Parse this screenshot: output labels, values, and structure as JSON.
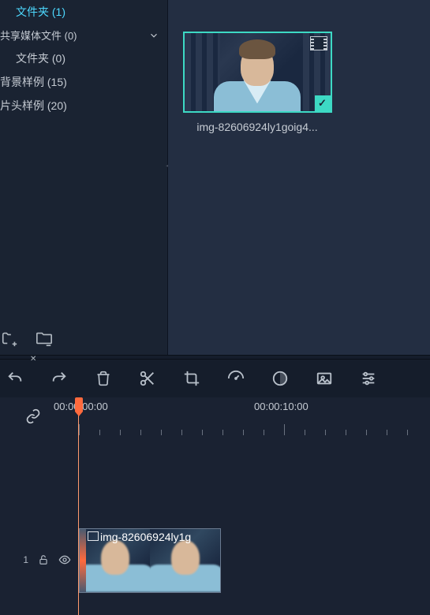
{
  "sidebar": {
    "items": [
      {
        "label": "文件夹 (1)",
        "selected": true,
        "indent": 1
      },
      {
        "label": "共享媒体文件 (0)",
        "expandable": true,
        "indent": 0
      },
      {
        "label": "文件夹 (0)",
        "indent": 2
      },
      {
        "label": "背景样例 (15)",
        "indent": 0
      },
      {
        "label": "片头样例 (20)",
        "indent": 0
      }
    ]
  },
  "media": {
    "thumb_label": "img-82606924ly1goig4...",
    "checkmark": "✓"
  },
  "timeline": {
    "tc_start": "00:00:00:00",
    "tc_mark": "00:00:10:00",
    "track_label": "1",
    "clip_label": "img-82606924ly1g"
  },
  "toolbar": {
    "undo": "undo",
    "redo": "redo",
    "delete": "delete",
    "cut": "cut",
    "crop": "crop",
    "speed": "speed",
    "color": "color",
    "green_screen": "green-screen",
    "adjust": "adjust"
  },
  "colors": {
    "accent": "#3dd9c4",
    "playhead": "#ff6a3d",
    "bg_dark": "#1a2332",
    "bg_panel": "#232e42"
  }
}
